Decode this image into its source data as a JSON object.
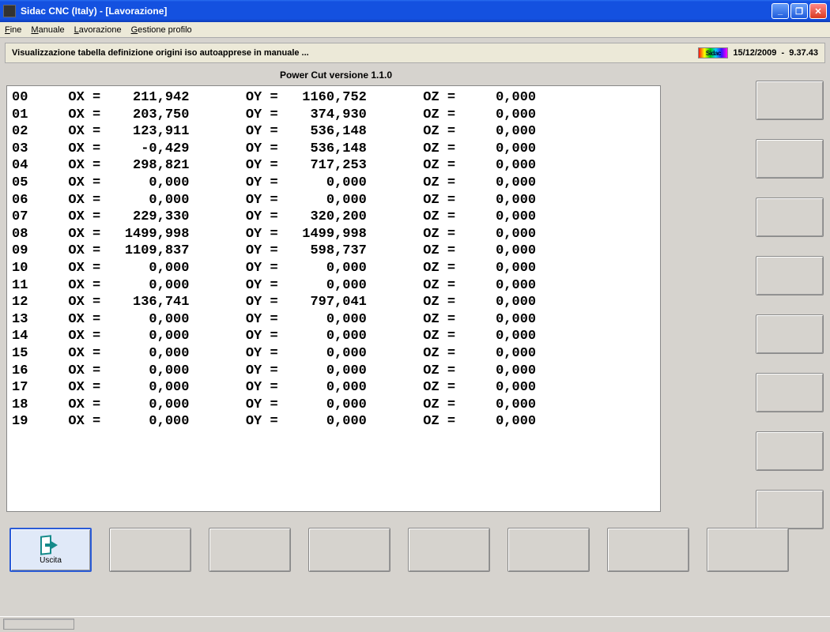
{
  "window": {
    "title": "Sidac CNC (Italy) - [Lavorazione]"
  },
  "menu": {
    "items": [
      "Fine",
      "Manuale",
      "Lavorazione",
      "Gestione profilo"
    ]
  },
  "subheader": {
    "text": "Visualizzazione tabella definizione origini iso autoapprese in manuale ...",
    "logo_text": "Sidac",
    "date": "15/12/2009",
    "time": "9.37.43"
  },
  "version_label": "Power Cut versione 1.1.0",
  "columns": {
    "ox": "OX =",
    "oy": "OY =",
    "oz": "OZ ="
  },
  "rows": [
    {
      "id": "00",
      "ox": "211,942",
      "oy": "1160,752",
      "oz": "0,000"
    },
    {
      "id": "01",
      "ox": "203,750",
      "oy": "374,930",
      "oz": "0,000"
    },
    {
      "id": "02",
      "ox": "123,911",
      "oy": "536,148",
      "oz": "0,000"
    },
    {
      "id": "03",
      "ox": "-0,429",
      "oy": "536,148",
      "oz": "0,000"
    },
    {
      "id": "04",
      "ox": "298,821",
      "oy": "717,253",
      "oz": "0,000"
    },
    {
      "id": "05",
      "ox": "0,000",
      "oy": "0,000",
      "oz": "0,000"
    },
    {
      "id": "06",
      "ox": "0,000",
      "oy": "0,000",
      "oz": "0,000"
    },
    {
      "id": "07",
      "ox": "229,330",
      "oy": "320,200",
      "oz": "0,000"
    },
    {
      "id": "08",
      "ox": "1499,998",
      "oy": "1499,998",
      "oz": "0,000"
    },
    {
      "id": "09",
      "ox": "1109,837",
      "oy": "598,737",
      "oz": "0,000"
    },
    {
      "id": "10",
      "ox": "0,000",
      "oy": "0,000",
      "oz": "0,000"
    },
    {
      "id": "11",
      "ox": "0,000",
      "oy": "0,000",
      "oz": "0,000"
    },
    {
      "id": "12",
      "ox": "136,741",
      "oy": "797,041",
      "oz": "0,000"
    },
    {
      "id": "13",
      "ox": "0,000",
      "oy": "0,000",
      "oz": "0,000"
    },
    {
      "id": "14",
      "ox": "0,000",
      "oy": "0,000",
      "oz": "0,000"
    },
    {
      "id": "15",
      "ox": "0,000",
      "oy": "0,000",
      "oz": "0,000"
    },
    {
      "id": "16",
      "ox": "0,000",
      "oy": "0,000",
      "oz": "0,000"
    },
    {
      "id": "17",
      "ox": "0,000",
      "oy": "0,000",
      "oz": "0,000"
    },
    {
      "id": "18",
      "ox": "0,000",
      "oy": "0,000",
      "oz": "0,000"
    },
    {
      "id": "19",
      "ox": "0,000",
      "oy": "0,000",
      "oz": "0,000"
    }
  ],
  "bottom_buttons": {
    "exit_label": "Uscita"
  }
}
